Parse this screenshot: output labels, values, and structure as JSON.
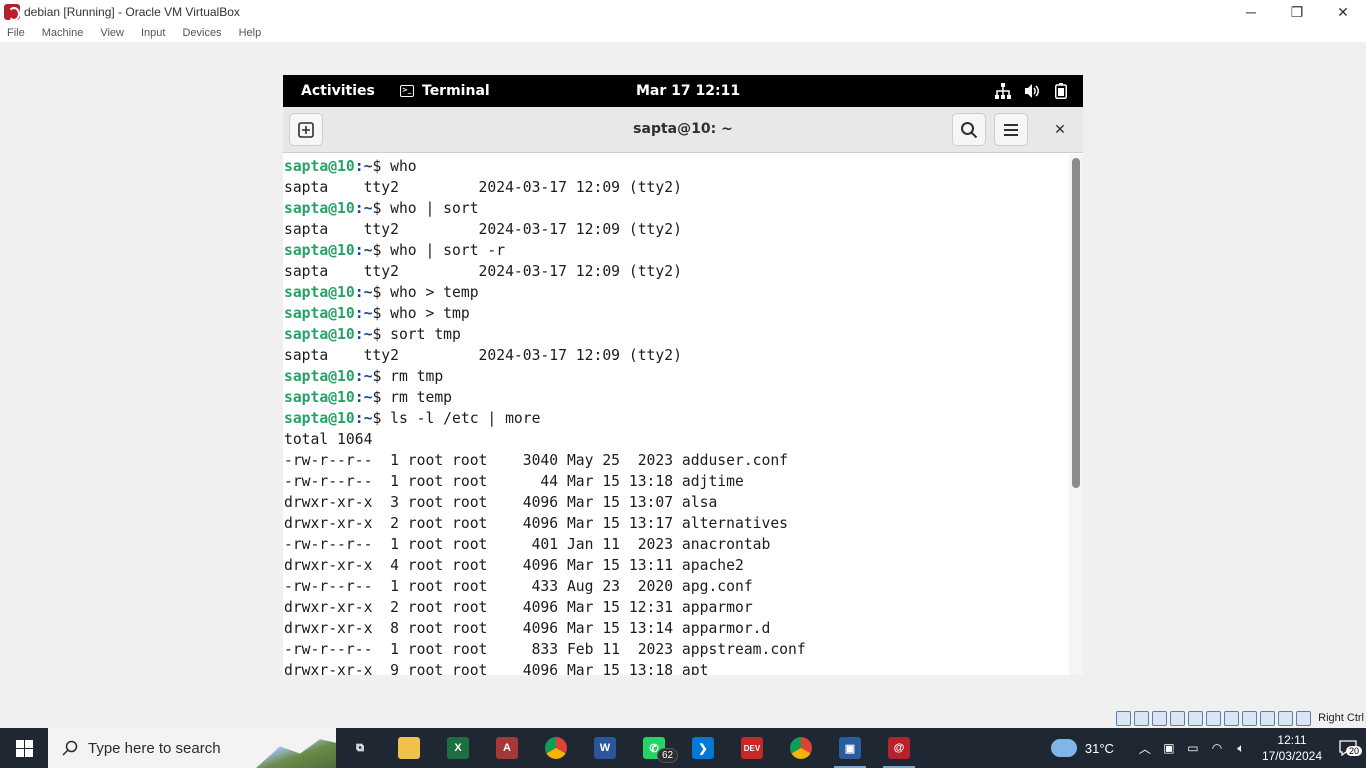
{
  "host_window": {
    "title": "debian [Running] - Oracle VM VirtualBox",
    "controls": {
      "minimize": "─",
      "restore": "❐",
      "close": "✕"
    },
    "menu": [
      "File",
      "Machine",
      "View",
      "Input",
      "Devices",
      "Help"
    ]
  },
  "gnome_bar": {
    "activities": "Activities",
    "app_name": "Terminal",
    "clock": "Mar 17  12:11",
    "tray_icons": [
      "network-icon",
      "volume-icon",
      "battery-icon"
    ]
  },
  "terminal": {
    "title": "sapta@10: ~",
    "new_tab_icon": "new-tab-icon",
    "search_icon": "search-icon",
    "menu_icon": "hamburger-menu-icon",
    "close": "✕",
    "prompt_user": "sapta@10",
    "prompt_path": ":~",
    "prompt_symbol": "$ ",
    "lines": [
      {
        "type": "prompt",
        "cmd": "who"
      },
      {
        "type": "output",
        "text": "sapta    tty2         2024-03-17 12:09 (tty2)"
      },
      {
        "type": "prompt",
        "cmd": "who | sort"
      },
      {
        "type": "output",
        "text": "sapta    tty2         2024-03-17 12:09 (tty2)"
      },
      {
        "type": "prompt",
        "cmd": "who | sort -r"
      },
      {
        "type": "output",
        "text": "sapta    tty2         2024-03-17 12:09 (tty2)"
      },
      {
        "type": "prompt",
        "cmd": "who > temp"
      },
      {
        "type": "prompt",
        "cmd": "who > tmp"
      },
      {
        "type": "prompt",
        "cmd": "sort tmp"
      },
      {
        "type": "output",
        "text": "sapta    tty2         2024-03-17 12:09 (tty2)"
      },
      {
        "type": "prompt",
        "cmd": "rm tmp"
      },
      {
        "type": "prompt",
        "cmd": "rm temp"
      },
      {
        "type": "prompt",
        "cmd": "ls -l /etc | more"
      },
      {
        "type": "output",
        "text": "total 1064"
      },
      {
        "type": "output",
        "text": "-rw-r--r--  1 root root    3040 May 25  2023 adduser.conf"
      },
      {
        "type": "output",
        "text": "-rw-r--r--  1 root root      44 Mar 15 13:18 adjtime"
      },
      {
        "type": "output",
        "text": "drwxr-xr-x  3 root root    4096 Mar 15 13:07 alsa"
      },
      {
        "type": "output",
        "text": "drwxr-xr-x  2 root root    4096 Mar 15 13:17 alternatives"
      },
      {
        "type": "output",
        "text": "-rw-r--r--  1 root root     401 Jan 11  2023 anacrontab"
      },
      {
        "type": "output",
        "text": "drwxr-xr-x  4 root root    4096 Mar 15 13:11 apache2"
      },
      {
        "type": "output",
        "text": "-rw-r--r--  1 root root     433 Aug 23  2020 apg.conf"
      },
      {
        "type": "output",
        "text": "drwxr-xr-x  2 root root    4096 Mar 15 12:31 apparmor"
      },
      {
        "type": "output",
        "text": "drwxr-xr-x  8 root root    4096 Mar 15 13:14 apparmor.d"
      },
      {
        "type": "output",
        "text": "-rw-r--r--  1 root root     833 Feb 11  2023 appstream.conf"
      },
      {
        "type": "output",
        "text": "drwxr-xr-x  9 root root    4096 Mar 15 13:18 apt"
      }
    ]
  },
  "vb_status": {
    "host_key": "Right Ctrl"
  },
  "taskbar": {
    "search_placeholder": "Type here to search",
    "apps": [
      {
        "name": "task-view",
        "glyph": "⧉",
        "color": "#1f2733"
      },
      {
        "name": "file-explorer",
        "glyph": "",
        "color": "#f0c14b"
      },
      {
        "name": "excel",
        "glyph": "X",
        "color": "#1d6f42"
      },
      {
        "name": "access",
        "glyph": "A",
        "color": "#a4373a"
      },
      {
        "name": "chrome",
        "glyph": "",
        "color": "#db4437"
      },
      {
        "name": "word",
        "glyph": "W",
        "color": "#2b579a"
      },
      {
        "name": "whatsapp",
        "glyph": "✆",
        "color": "#25d366",
        "badge": "62"
      },
      {
        "name": "vscode",
        "glyph": "❯",
        "color": "#0078d4"
      },
      {
        "name": "devcpp",
        "glyph": "DEV",
        "color": "#c62828"
      },
      {
        "name": "chrome-2",
        "glyph": "",
        "color": "#db4437"
      },
      {
        "name": "virtualbox",
        "glyph": "▣",
        "color": "#2a5d9f"
      },
      {
        "name": "debian-vm",
        "glyph": "@",
        "color": "#b8202d"
      }
    ],
    "weather_temp": "31°C",
    "time": "12:11",
    "date": "17/03/2024",
    "notification_count": "20"
  }
}
